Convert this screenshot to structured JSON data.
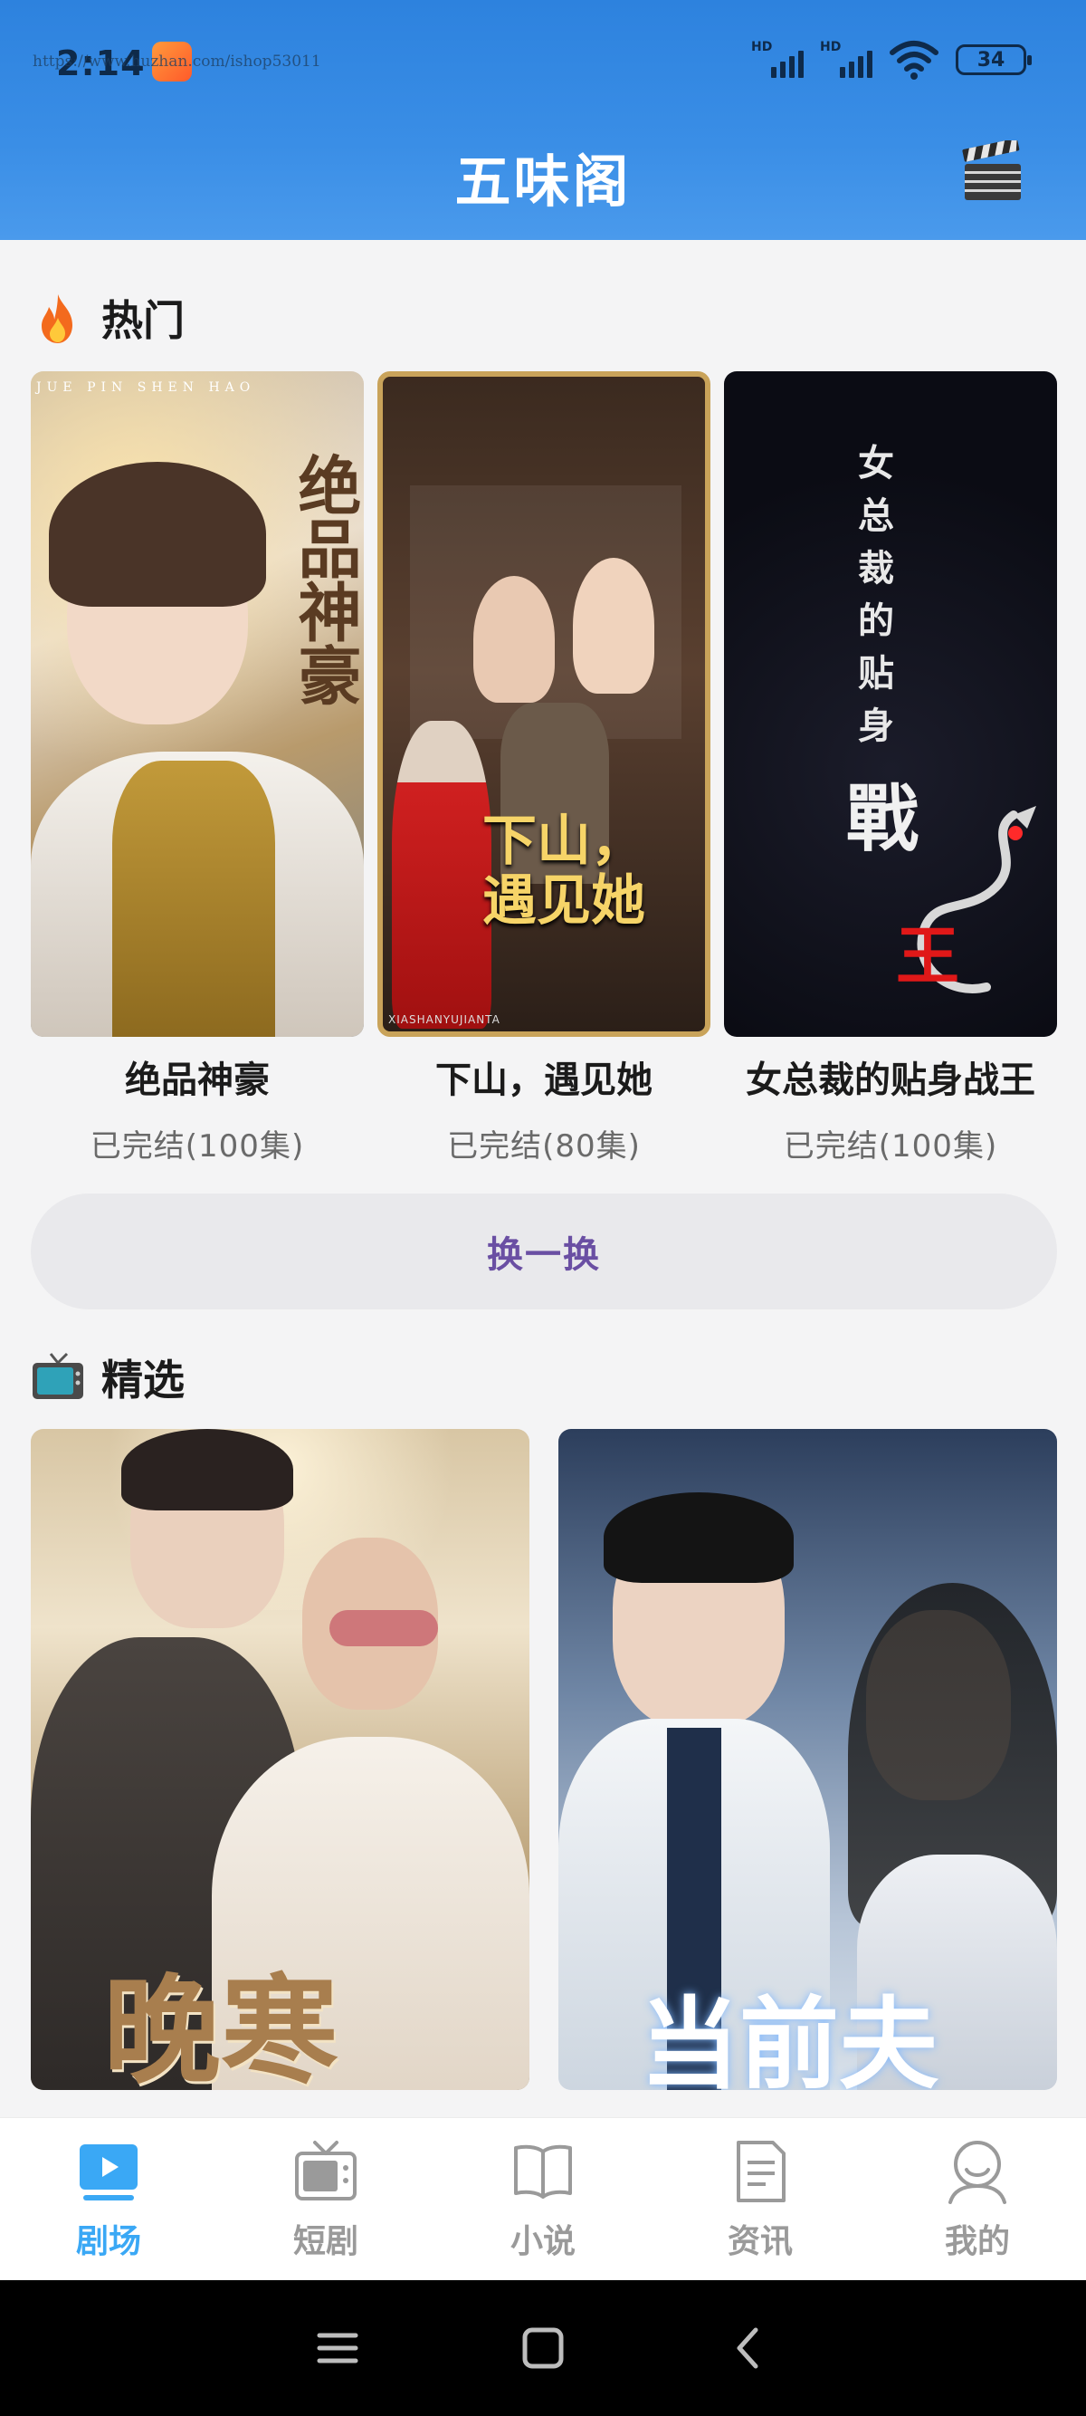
{
  "status_bar": {
    "time": "2:14",
    "watermark": "https://www.huzhan.com/ishop53011",
    "battery": "34",
    "signal1_label": "HD",
    "signal2_label": "HD"
  },
  "header": {
    "title": "五味阁",
    "action_icon": "clapperboard-icon"
  },
  "hot_section": {
    "title": "热门",
    "icon": "fire-icon",
    "items": [
      {
        "title": "绝品神豪",
        "status": "已完结(100集)",
        "poster_text": "绝品神豪",
        "poster_sub": "JUE PIN SHEN HAO"
      },
      {
        "title": "下山，遇见她",
        "status": "已完结(80集)",
        "poster_text": "下山，\n遇见她",
        "poster_sub": "XIASHANYUJIANTA"
      },
      {
        "title": "女总裁的贴身战王",
        "status": "已完结(100集)",
        "poster_text": "女总裁的贴身",
        "poster_big1": "戰",
        "poster_big2": "王"
      }
    ],
    "refresh_label": "换一换"
  },
  "picks_section": {
    "title": "精选",
    "icon": "tv-icon",
    "items": [
      {
        "poster_text": "晚寒"
      },
      {
        "poster_text": "当前夫"
      }
    ]
  },
  "bottom_nav": {
    "items": [
      {
        "label": "剧场",
        "icon": "theater-play-icon",
        "active": true
      },
      {
        "label": "短剧",
        "icon": "tv-set-icon",
        "active": false
      },
      {
        "label": "小说",
        "icon": "book-icon",
        "active": false
      },
      {
        "label": "资讯",
        "icon": "document-icon",
        "active": false
      },
      {
        "label": "我的",
        "icon": "user-icon",
        "active": false
      }
    ]
  },
  "colors": {
    "header_blue": "#3a8ee6",
    "active_tab": "#3aa8f5",
    "refresh_text": "#6a4fa3"
  }
}
